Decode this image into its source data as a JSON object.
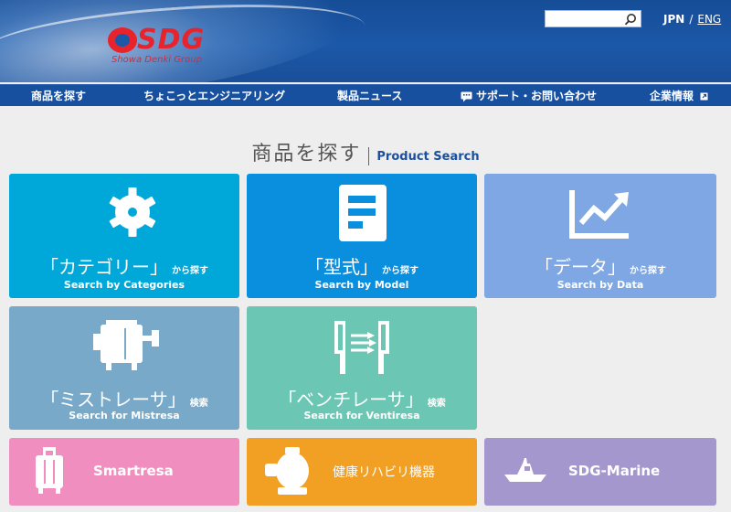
{
  "header": {
    "logo_text": "SDG",
    "logo_subtitle": "Showa Denki Group",
    "search_placeholder": "",
    "lang_jpn": "JPN",
    "lang_sep": "/",
    "lang_eng": "ENG"
  },
  "nav": {
    "items": [
      {
        "label": "商品を探す"
      },
      {
        "label": "ちょこっとエンジニアリング"
      },
      {
        "label": "製品ニュース"
      },
      {
        "label": "サポート・お問い合わせ",
        "icon": "chat-bubble-icon"
      },
      {
        "label": "企業情報",
        "icon": "external-link-icon"
      }
    ]
  },
  "title": {
    "ja": "商品を探す",
    "en": "Product Search"
  },
  "tiles": {
    "categories": {
      "ja": "「カテゴリー」",
      "suffix": "から探す",
      "en": "Search by Categories",
      "icon": "fan-gear-icon",
      "color": "#00a7d9"
    },
    "model": {
      "ja": "「型式」",
      "suffix": "から探す",
      "en": "Search by Model",
      "icon": "document-list-icon",
      "color": "#0a8fdf"
    },
    "data": {
      "ja": "「データ」",
      "suffix": "から探す",
      "en": "Search by Data",
      "icon": "line-chart-icon",
      "color": "#7fa7e4"
    },
    "mistresa": {
      "ja": "「ミストレーサ」",
      "suffix": "検索",
      "en": "Search for Mistresa",
      "icon": "mist-collector-icon",
      "color": "#78a9c8"
    },
    "ventiresa": {
      "ja": "「ベンチレーサ」",
      "suffix": "検索",
      "en": "Search for Ventiresa",
      "icon": "ventilation-icon",
      "color": "#6cc6b4"
    },
    "smartresa": {
      "label": "Smartresa",
      "icon": "suitcase-icon",
      "color": "#f08fbf"
    },
    "rehab": {
      "label": "健康リハビリ機器",
      "icon": "rehab-device-icon",
      "color": "#f2a024"
    },
    "marine": {
      "label": "SDG-Marine",
      "icon": "boat-icon",
      "color": "#a497ce"
    }
  }
}
